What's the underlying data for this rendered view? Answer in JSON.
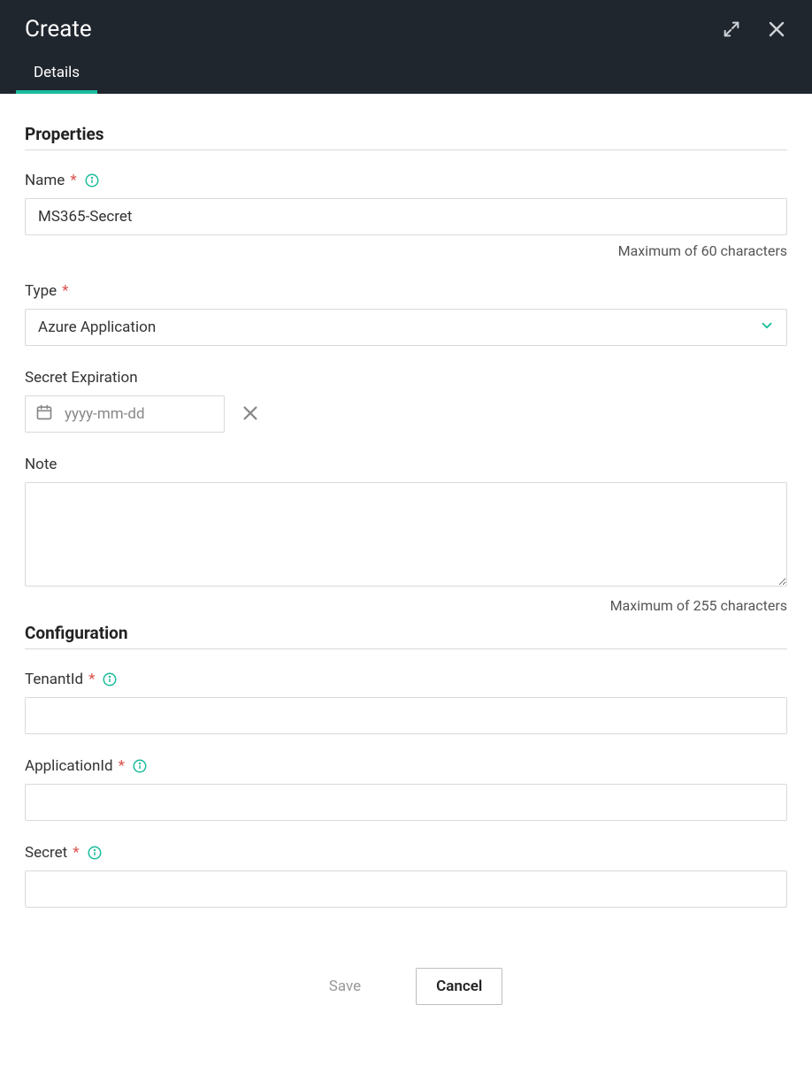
{
  "header": {
    "title": "Create",
    "tabs": [
      {
        "label": "Details",
        "active": true
      }
    ]
  },
  "sections": {
    "properties": {
      "title": "Properties",
      "fields": {
        "name": {
          "label": "Name",
          "required": true,
          "value": "MS365-Secret",
          "helper": "Maximum of 60 characters"
        },
        "type": {
          "label": "Type",
          "required": true,
          "value": "Azure Application"
        },
        "secret_expiration": {
          "label": "Secret Expiration",
          "placeholder": "yyyy-mm-dd",
          "value": ""
        },
        "note": {
          "label": "Note",
          "value": "",
          "helper": "Maximum of 255 characters"
        }
      }
    },
    "configuration": {
      "title": "Configuration",
      "fields": {
        "tenant_id": {
          "label": "TenantId",
          "required": true,
          "value": ""
        },
        "application_id": {
          "label": "ApplicationId",
          "required": true,
          "value": ""
        },
        "secret": {
          "label": "Secret",
          "required": true,
          "value": ""
        }
      }
    }
  },
  "footer": {
    "save_label": "Save",
    "cancel_label": "Cancel"
  }
}
